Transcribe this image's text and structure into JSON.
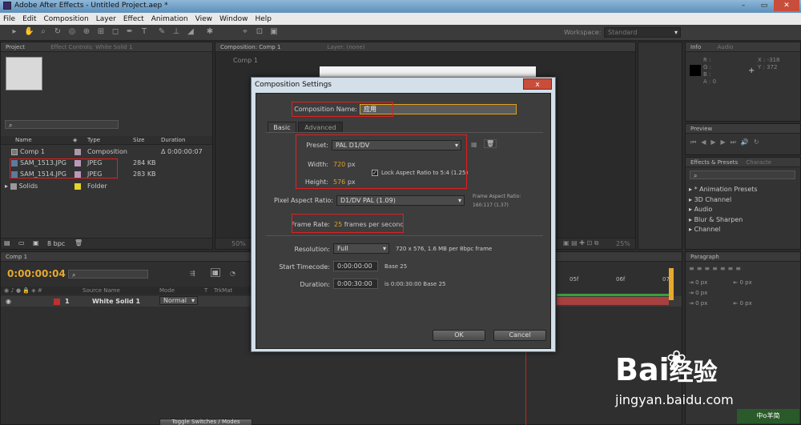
{
  "titlebar": {
    "title": "Adobe After Effects - Untitled Project.aep *"
  },
  "menu": [
    "File",
    "Edit",
    "Composition",
    "Layer",
    "Effect",
    "Animation",
    "View",
    "Window",
    "Help"
  ],
  "toolbar": {
    "workspace_label": "Workspace:",
    "workspace_value": "Standard"
  },
  "project_panel": {
    "tabs": [
      "Project",
      "Effect Controls: White Solid 1"
    ],
    "columns": [
      "Name",
      "Type",
      "Size",
      "Duration"
    ],
    "items": [
      {
        "name": "Comp 1",
        "type": "Composition",
        "size": "",
        "duration": "Δ 0:00:00:07"
      },
      {
        "name": "SAM_1513.JPG",
        "type": "JPEG",
        "size": "284 KB",
        "duration": ""
      },
      {
        "name": "SAM_1514.JPG",
        "type": "JPEG",
        "size": "283 KB",
        "duration": ""
      },
      {
        "name": "Solids",
        "type": "Folder",
        "size": "",
        "duration": ""
      }
    ],
    "bpc": "8 bpc"
  },
  "comp_panel": {
    "tab": "Composition: Comp 1",
    "layer_tab": "Layer: (none)",
    "sub": "Comp 1",
    "zoom_left": "50%",
    "zoom_right": "25%"
  },
  "info_panel": {
    "tabs": [
      "Info",
      "Audio"
    ],
    "r": "R :",
    "g": "G :",
    "b": "B :",
    "a": "A : 0",
    "x": "X : -318",
    "y": "Y : 372"
  },
  "preview_panel": {
    "tab": "Preview"
  },
  "effects_panel": {
    "tabs": [
      "Effects & Presets",
      "Characte"
    ],
    "items": [
      "* Animation Presets",
      "3D Channel",
      "Audio",
      "Blur & Sharpen",
      "Channel"
    ]
  },
  "paragraph_panel": {
    "tab": "Paragraph",
    "px": [
      "0 px",
      "0 px",
      "0 px",
      "0 px",
      "0 px"
    ]
  },
  "timeline": {
    "tab": "Comp 1",
    "timecode": "0:00:00:04",
    "columns": [
      "Source Name",
      "Mode",
      "T",
      "TrkMat"
    ],
    "layer": {
      "num": "1",
      "name": "White Solid 1",
      "mode": "Normal"
    },
    "ruler": [
      "05f",
      "06f",
      "07"
    ],
    "toggle": "Toggle Switches / Modes"
  },
  "dialog": {
    "title": "Composition Settings",
    "close": "x",
    "comp_name_label": "Composition Name:",
    "comp_name_value": "应用",
    "tabs": [
      "Basic",
      "Advanced"
    ],
    "preset_label": "Preset:",
    "preset_value": "PAL D1/DV",
    "width_label": "Width:",
    "width_value": "720",
    "height_label": "Height:",
    "height_value": "576",
    "px_unit": "px",
    "lock_label": "Lock Aspect Ratio to 5:4 (1.25)",
    "par_label": "Pixel Aspect Ratio:",
    "par_value": "D1/DV PAL (1.09)",
    "far_label": "Frame Aspect Ratio:",
    "far_value": "160:117 (1.37)",
    "fr_label": "Frame Rate:",
    "fr_value": "25",
    "fr_unit": "frames per second",
    "res_label": "Resolution:",
    "res_value": "Full",
    "res_info": "720 x 576, 1.6 MB per 8bpc frame",
    "st_label": "Start Timecode:",
    "st_value": "0:00:00:00",
    "st_info": "Base 25",
    "dur_label": "Duration:",
    "dur_value": "0:00:30:00",
    "dur_info": "is 0:00:30:00  Base 25",
    "ok": "OK",
    "cancel": "Cancel"
  },
  "watermark": {
    "brand": "Bai",
    "brand2": "经验",
    "url": "jingyan.baidu.com",
    "corner": "中o羊简"
  }
}
